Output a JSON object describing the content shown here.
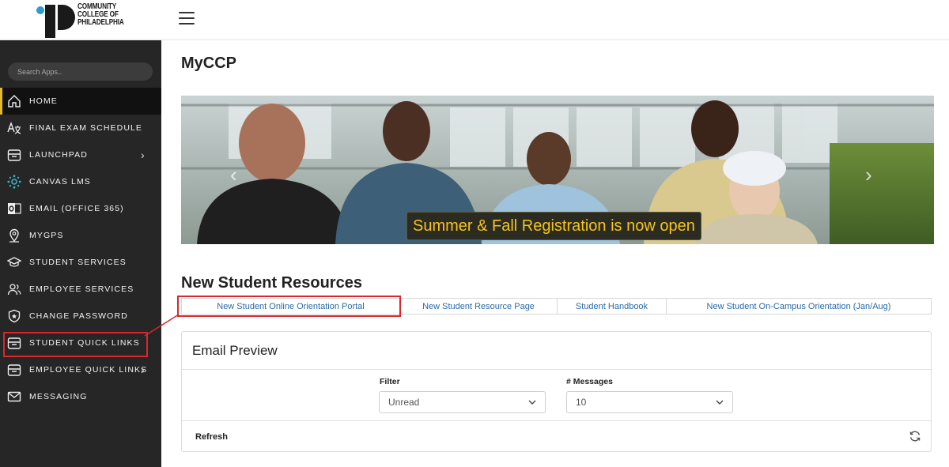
{
  "header": {
    "logo_lines": [
      "COMMUNITY",
      "COLLEGE OF",
      "PHILADELPHIA"
    ]
  },
  "sidebar": {
    "search_placeholder": "Search Apps..",
    "items": [
      {
        "label": "HOME",
        "icon": "home-icon",
        "active": true
      },
      {
        "label": "FINAL EXAM SCHEDULE",
        "icon": "translate-icon"
      },
      {
        "label": "LAUNCHPAD",
        "icon": "tray-icon",
        "has_children": true
      },
      {
        "label": "CANVAS LMS",
        "icon": "canvas-icon"
      },
      {
        "label": "EMAIL (OFFICE 365)",
        "icon": "outlook-icon"
      },
      {
        "label": "MYGPS",
        "icon": "location-pin-icon"
      },
      {
        "label": "STUDENT SERVICES",
        "icon": "graduation-cap-icon"
      },
      {
        "label": "EMPLOYEE SERVICES",
        "icon": "users-icon"
      },
      {
        "label": "CHANGE PASSWORD",
        "icon": "shield-icon"
      },
      {
        "label": "STUDENT QUICK LINKS",
        "icon": "tray-icon",
        "highlighted": true
      },
      {
        "label": "EMPLOYEE QUICK LINKS",
        "icon": "tray-icon",
        "has_children": true
      },
      {
        "label": "MESSAGING",
        "icon": "envelope-icon"
      }
    ]
  },
  "main": {
    "title": "MyCCP",
    "banner": {
      "caption": "Summer & Fall Registration is now open",
      "prev_icon": "chevron-left-icon",
      "next_icon": "chevron-right-icon"
    },
    "resources": {
      "title": "New Student Resources",
      "links": [
        "New Student Online Orientation Portal",
        "New Student Resource Page",
        "Student Handbook",
        "New Student On-Campus Orientation (Jan/Aug)"
      ]
    },
    "email_preview": {
      "title": "Email Preview",
      "filter_label": "Filter",
      "filter_value": "Unread",
      "messages_label": "# Messages",
      "messages_value": "10",
      "refresh_label": "Refresh"
    }
  },
  "colors": {
    "sidebar_bg": "#262626",
    "accent": "#e8b926",
    "highlight": "#d9272e",
    "link": "#2a6aa8",
    "caption_text": "#f5c518"
  }
}
